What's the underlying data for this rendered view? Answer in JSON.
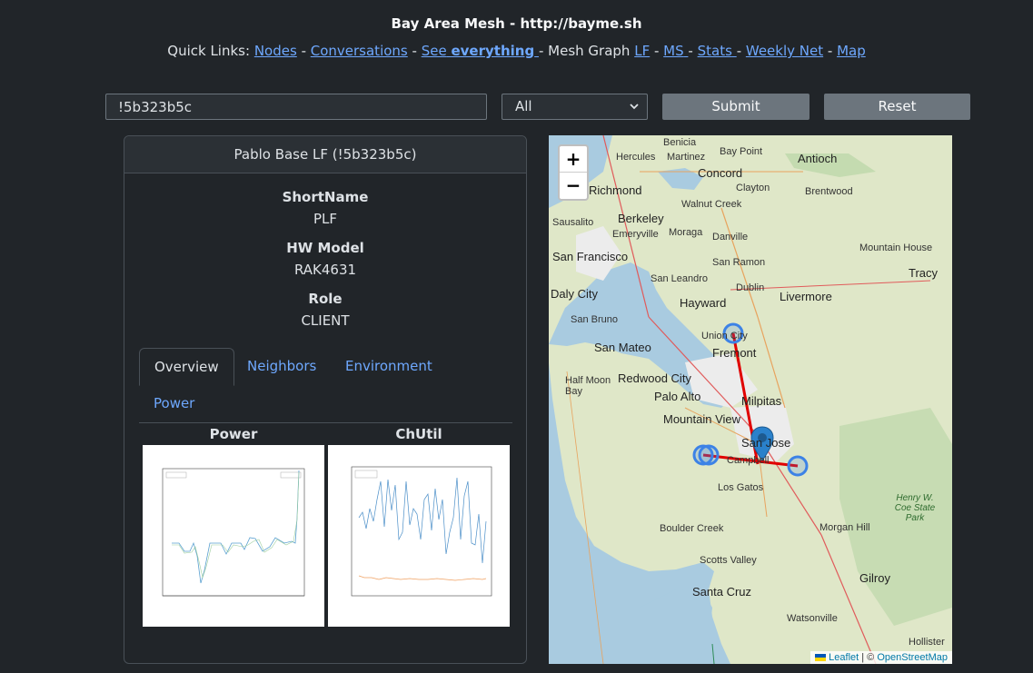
{
  "header": {
    "title": "Bay Area Mesh - http://bayme.sh",
    "quick_links_label": "Quick Links:",
    "links": {
      "nodes": "Nodes",
      "conversations": "Conversations",
      "see": "See",
      "everything": "everything",
      "mesh_graph": "Mesh Graph",
      "lf": "LF",
      "ms": "MS",
      "stats": "Stats",
      "weekly_net": "Weekly Net",
      "map": "Map"
    }
  },
  "search": {
    "value": "!5b323b5c",
    "select_value": "All",
    "submit_label": "Submit",
    "reset_label": "Reset"
  },
  "node": {
    "header": "Pablo Base LF (!5b323b5c)",
    "short_name_label": "ShortName",
    "short_name": "PLF",
    "hw_model_label": "HW Model",
    "hw_model": "RAK4631",
    "role_label": "Role",
    "role": "CLIENT"
  },
  "tabs": {
    "overview": "Overview",
    "neighbors": "Neighbors",
    "environment": "Environment",
    "power": "Power"
  },
  "charts": {
    "power_title": "Power",
    "chutil_title": "ChUtil"
  },
  "map": {
    "zoom_in": "+",
    "zoom_out": "−",
    "attribution_leaflet": "Leaflet",
    "attribution_sep": "| ©",
    "attribution_osm": "OpenStreetMap",
    "places": {
      "benicia": "Benicia",
      "hercules": "Hercules",
      "martinez": "Martinez",
      "bay_point": "Bay Point",
      "antioch": "Antioch",
      "concord": "Concord",
      "richmond": "Richmond",
      "clayton": "Clayton",
      "brentwood": "Brentwood",
      "walnut_creek": "Walnut Creek",
      "berkeley": "Berkeley",
      "sausalito": "Sausalito",
      "emeryville": "Emeryville",
      "moraga": "Moraga",
      "danville": "Danville",
      "san_francisco": "San Francisco",
      "san_ramon": "San Ramon",
      "mountain_house": "Mountain House",
      "tracy": "Tracy",
      "san_leandro": "San Leandro",
      "dublin": "Dublin",
      "daly_city": "Daly City",
      "hayward": "Hayward",
      "livermore": "Livermore",
      "san_bruno": "San Bruno",
      "union_city": "Union City",
      "san_mateo": "San Mateo",
      "fremont": "Fremont",
      "redwood_city": "Redwood City",
      "half_moon_bay": "Half Moon Bay",
      "palo_alto": "Palo Alto",
      "milpitas": "Milpitas",
      "mountain_view": "Mountain View",
      "san_jose": "San Jose",
      "campbell": "Campbell",
      "los_gatos": "Los Gatos",
      "henry_coe": "Henry W. Coe State Park",
      "boulder_creek": "Boulder Creek",
      "morgan_hill": "Morgan Hill",
      "scotts_valley": "Scotts Valley",
      "gilroy": "Gilroy",
      "santa_cruz": "Santa Cruz",
      "watsonville": "Watsonville",
      "hollister": "Hollister"
    }
  }
}
